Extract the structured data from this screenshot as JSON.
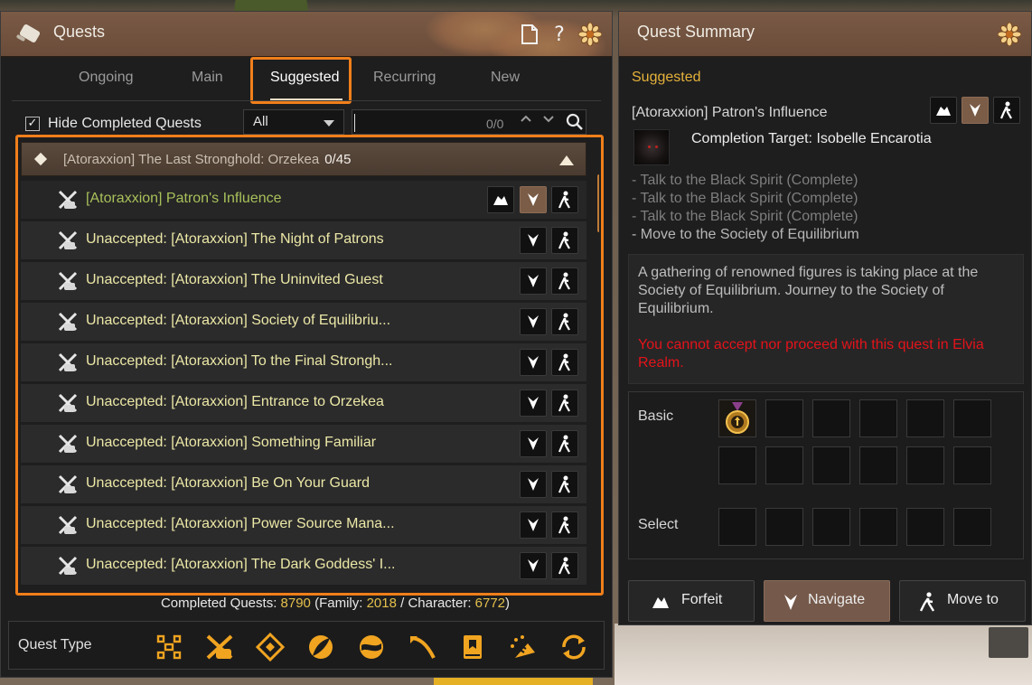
{
  "quests_window": {
    "title": "Quests",
    "header_icons": [
      "document-icon",
      "help-icon",
      "settings-flower-icon"
    ],
    "help_symbol": "?",
    "tabs": [
      {
        "label": "Ongoing",
        "active": false
      },
      {
        "label": "Main",
        "active": false
      },
      {
        "label": "Suggested",
        "active": true
      },
      {
        "label": "Recurring",
        "active": false
      },
      {
        "label": "New",
        "active": false
      }
    ],
    "filters": {
      "hide_completed_checked": true,
      "hide_completed_label": "Hide Completed Quests",
      "category_selected": "All",
      "search_value": "",
      "search_count": "0/0"
    },
    "group": {
      "title": "[Atoraxxion] The Last Stronghold: Orzekea",
      "count": "0/45"
    },
    "quests": [
      {
        "name": "[Atoraxxion] Patron's Influence",
        "accepted": true
      },
      {
        "name": "Unaccepted: [Atoraxxion] The Night of Patrons",
        "accepted": false
      },
      {
        "name": "Unaccepted: [Atoraxxion] The Uninvited Guest",
        "accepted": false
      },
      {
        "name": "Unaccepted: [Atoraxxion] Society of Equilibriu...",
        "accepted": false
      },
      {
        "name": "Unaccepted: [Atoraxxion] To the Final Strongh...",
        "accepted": false
      },
      {
        "name": "Unaccepted: [Atoraxxion] Entrance to Orzekea",
        "accepted": false
      },
      {
        "name": "Unaccepted: [Atoraxxion] Something Familiar",
        "accepted": false
      },
      {
        "name": "Unaccepted: [Atoraxxion] Be On Your Guard",
        "accepted": false
      },
      {
        "name": "Unaccepted: [Atoraxxion] Power Source Mana...",
        "accepted": false
      },
      {
        "name": "Unaccepted: [Atoraxxion] The Dark Goddess' I...",
        "accepted": false
      }
    ],
    "completed": {
      "label": "Completed Quests: ",
      "total": "8790",
      "family_label": " (Family: ",
      "family": "2018",
      "character_label": " / Character: ",
      "character": "6772",
      "close": ")"
    },
    "quest_type": {
      "label": "Quest Type",
      "icons": [
        "all-types-icon",
        "black-spirit-quest-icon",
        "diamond-quest-icon",
        "life-skill-quest-icon",
        "exploration-quest-icon",
        "combat-quest-icon",
        "book-quest-icon",
        "adventure-quest-icon",
        "repeat-quest-icon"
      ]
    },
    "accent_color": "#f07f1a"
  },
  "summary_window": {
    "title": "Quest Summary",
    "category": "Suggested",
    "quest_title": "[Atoraxxion] Patron's Influence",
    "completion_target": "Completion Target: Isobelle Encarotia",
    "objectives": [
      "- Talk to the Black Spirit (Complete)",
      "- Talk to the Black Spirit (Complete)",
      "- Talk to the Black Spirit (Complete)",
      "- Move to the Society of Equilibrium"
    ],
    "description": "A gathering of renowned figures is taking place at the Society of Equilibrium. Journey to the Society of Equilibrium.",
    "warning": "You cannot accept nor proceed with this quest in Elvia Realm.",
    "rewards": {
      "basic_label": "Basic",
      "select_label": "Select",
      "basic_items": [
        "medal-icon"
      ]
    },
    "actions": {
      "forfeit": "Forfeit",
      "navigate": "Navigate",
      "move_to": "Move to"
    },
    "warning_color": "#e4131a",
    "category_color": "#e5b23a"
  }
}
